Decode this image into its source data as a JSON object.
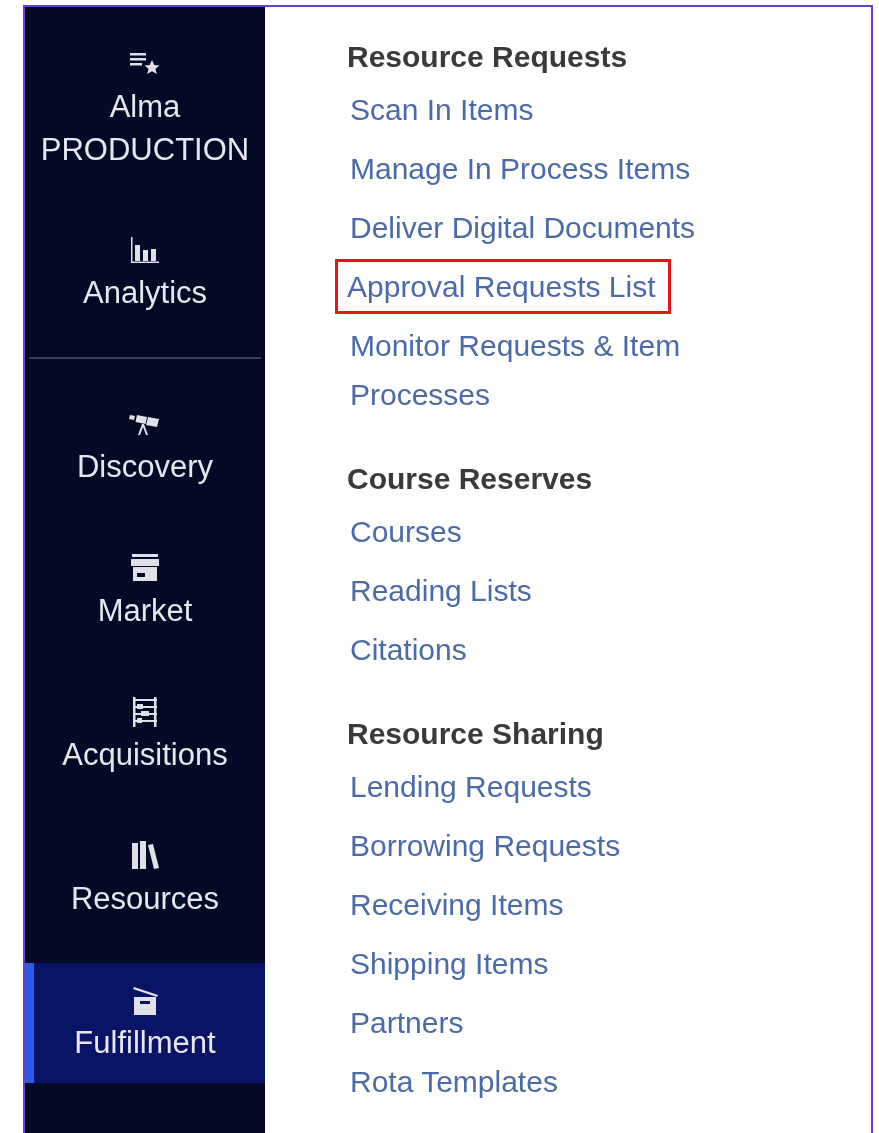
{
  "sidebar": {
    "header_items": [
      {
        "label": "Alma PRODUCTION",
        "selected": false
      },
      {
        "label": "Analytics",
        "selected": false
      }
    ],
    "items": [
      {
        "label": "Discovery",
        "selected": false
      },
      {
        "label": "Market",
        "selected": false
      },
      {
        "label": "Acquisitions",
        "selected": false
      },
      {
        "label": "Resources",
        "selected": false
      },
      {
        "label": "Fulfillment",
        "selected": true
      }
    ]
  },
  "sections": [
    {
      "title": "Resource Requests",
      "links": [
        {
          "label": "Scan In Items",
          "highlighted": false
        },
        {
          "label": "Manage In Process Items",
          "highlighted": false
        },
        {
          "label": "Deliver Digital Documents",
          "highlighted": false
        },
        {
          "label": "Approval Requests List",
          "highlighted": true
        },
        {
          "label": "Monitor Requests & Item Processes",
          "highlighted": false
        }
      ]
    },
    {
      "title": "Course Reserves",
      "links": [
        {
          "label": "Courses",
          "highlighted": false
        },
        {
          "label": "Reading Lists",
          "highlighted": false
        },
        {
          "label": "Citations",
          "highlighted": false
        }
      ]
    },
    {
      "title": "Resource Sharing",
      "links": [
        {
          "label": "Lending Requests",
          "highlighted": false
        },
        {
          "label": "Borrowing Requests",
          "highlighted": false
        },
        {
          "label": "Receiving Items",
          "highlighted": false
        },
        {
          "label": "Shipping Items",
          "highlighted": false
        },
        {
          "label": "Partners",
          "highlighted": false
        },
        {
          "label": "Rota Templates",
          "highlighted": false
        }
      ]
    }
  ]
}
